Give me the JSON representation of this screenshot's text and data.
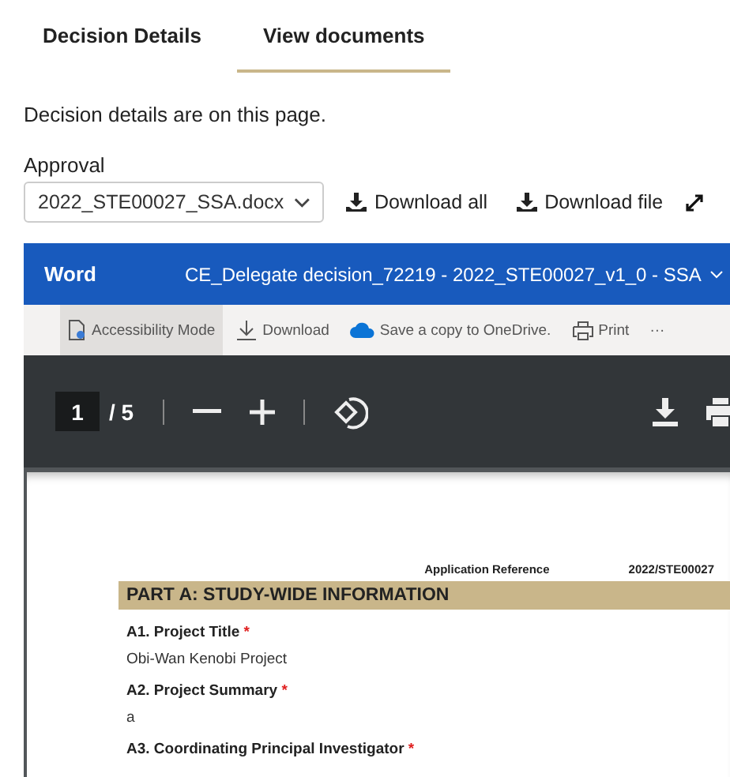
{
  "tabs": [
    {
      "label": "Decision Details",
      "selected": false
    },
    {
      "label": "View documents",
      "selected": true
    }
  ],
  "intro": "Decision details are on this page.",
  "document_select": {
    "label": "Approval",
    "value": "2022_STE00027_SSA.docx"
  },
  "actions": [
    "Download all",
    "Download file"
  ],
  "viewer": {
    "app": "Word",
    "title": "CE_Delegate decision_72219 - 2022_STE00027_v1_0 - SSA",
    "toolbar": [
      {
        "kind": "accessibility",
        "label": "Accessibility Mode",
        "selected": true
      },
      {
        "kind": "download",
        "label": "Download",
        "selected": false
      },
      {
        "kind": "cloud",
        "label": "Save a copy to OneDrive.",
        "selected": false
      },
      {
        "kind": "print",
        "label": "Print",
        "selected": false
      },
      {
        "kind": "more",
        "label": "···",
        "selected": false
      }
    ],
    "page_number": "1",
    "page_total": "/ 5"
  },
  "document": {
    "reference_label": "Application Reference",
    "reference_value": "2022/STE00027",
    "section": "PART A: STUDY-WIDE INFORMATION",
    "fields": [
      {
        "label": "A1. Project Title",
        "mark": "*",
        "value": "Obi-Wan Kenobi Project"
      },
      {
        "label": "A2. Project Summary",
        "mark": "*",
        "value": "a"
      },
      {
        "label": "A3. Coordinating Principal Investigator",
        "mark": "*"
      }
    ]
  }
}
